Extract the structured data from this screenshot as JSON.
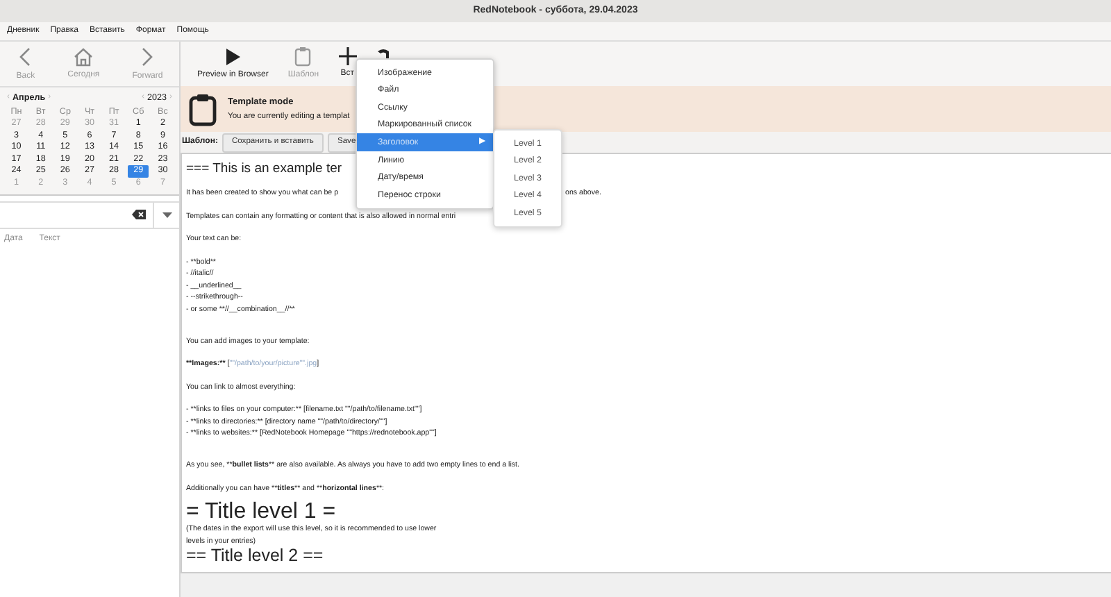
{
  "window": {
    "title": "RedNotebook - суббота, 29.04.2023"
  },
  "menubar": [
    "Дневник",
    "Правка",
    "Вставить",
    "Формат",
    "Помощь"
  ],
  "nav_buttons": [
    {
      "label": "Back",
      "kind": "back",
      "disabled": true
    },
    {
      "label": "Сегодня",
      "kind": "home",
      "disabled": true
    },
    {
      "label": "Forward",
      "kind": "forward",
      "disabled": true
    }
  ],
  "toolbar": [
    {
      "label": "Preview in Browser",
      "kind": "play",
      "disabled": false
    },
    {
      "label": "Шаблон",
      "kind": "template",
      "disabled": true
    },
    {
      "label": "Вст",
      "kind": "plus",
      "disabled": false
    },
    {
      "kind": "format",
      "disabled": false
    }
  ],
  "calendar": {
    "month": "Апрель",
    "year": "2023",
    "month_arrows": [
      "‹",
      "›"
    ],
    "year_arrows": [
      "‹",
      "›"
    ],
    "weekdays": [
      "Пн",
      "Вт",
      "Ср",
      "Чт",
      "Пт",
      "Сб",
      "Вс"
    ],
    "days": [
      {
        "day": "27",
        "other_month": true,
        "selected": false
      },
      {
        "day": "28",
        "other_month": true,
        "selected": false
      },
      {
        "day": "29",
        "other_month": true,
        "selected": false
      },
      {
        "day": "30",
        "other_month": true,
        "selected": false
      },
      {
        "day": "31",
        "other_month": true,
        "selected": false
      },
      {
        "day": "1",
        "other_month": false,
        "selected": false
      },
      {
        "day": "2",
        "other_month": false,
        "selected": false
      },
      {
        "day": "3",
        "other_month": false,
        "selected": false
      },
      {
        "day": "4",
        "other_month": false,
        "selected": false
      },
      {
        "day": "5",
        "other_month": false,
        "selected": false
      },
      {
        "day": "6",
        "other_month": false,
        "selected": false
      },
      {
        "day": "7",
        "other_month": false,
        "selected": false
      },
      {
        "day": "8",
        "other_month": false,
        "selected": false
      },
      {
        "day": "9",
        "other_month": false,
        "selected": false
      },
      {
        "day": "10",
        "other_month": false,
        "selected": false
      },
      {
        "day": "11",
        "other_month": false,
        "selected": false
      },
      {
        "day": "12",
        "other_month": false,
        "selected": false
      },
      {
        "day": "13",
        "other_month": false,
        "selected": false
      },
      {
        "day": "14",
        "other_month": false,
        "selected": false
      },
      {
        "day": "15",
        "other_month": false,
        "selected": false
      },
      {
        "day": "16",
        "other_month": false,
        "selected": false
      },
      {
        "day": "17",
        "other_month": false,
        "selected": false
      },
      {
        "day": "18",
        "other_month": false,
        "selected": false
      },
      {
        "day": "19",
        "other_month": false,
        "selected": false
      },
      {
        "day": "20",
        "other_month": false,
        "selected": false
      },
      {
        "day": "21",
        "other_month": false,
        "selected": false
      },
      {
        "day": "22",
        "other_month": false,
        "selected": false
      },
      {
        "day": "23",
        "other_month": false,
        "selected": false
      },
      {
        "day": "24",
        "other_month": false,
        "selected": false
      },
      {
        "day": "25",
        "other_month": false,
        "selected": false
      },
      {
        "day": "26",
        "other_month": false,
        "selected": false
      },
      {
        "day": "27",
        "other_month": false,
        "selected": false
      },
      {
        "day": "28",
        "other_month": false,
        "selected": false
      },
      {
        "day": "29",
        "other_month": false,
        "selected": true
      },
      {
        "day": "30",
        "other_month": false,
        "selected": false
      },
      {
        "day": "1",
        "other_month": true,
        "selected": false
      },
      {
        "day": "2",
        "other_month": true,
        "selected": false
      },
      {
        "day": "3",
        "other_month": true,
        "selected": false
      },
      {
        "day": "4",
        "other_month": true,
        "selected": false
      },
      {
        "day": "5",
        "other_month": true,
        "selected": false
      },
      {
        "day": "6",
        "other_month": true,
        "selected": false
      },
      {
        "day": "7",
        "other_month": true,
        "selected": false
      }
    ]
  },
  "entry_list": {
    "columns": [
      "Дата",
      "Текст"
    ]
  },
  "template_bar": {
    "title": "Template mode",
    "text": "You are currently editing a templat"
  },
  "template_actions": {
    "label": "Шаблон:",
    "buttons": [
      "Сохранить и вставить",
      "Save"
    ]
  },
  "editor": {
    "lines": [
      {
        "kind": "h3",
        "parts": [
          {
            "text": "=== This is an example ter"
          }
        ]
      },
      {
        "kind": "p",
        "parts": [
          {
            "text": "It has been created to show you what can be p"
          }
        ],
        "tail": "ons above."
      },
      {
        "kind": "p",
        "parts": [
          {
            "text": "Templates can contain any formatting or content that is also allowed in normal entri"
          }
        ]
      },
      {
        "kind": "p",
        "parts": [
          {
            "text": "Your text can be:"
          }
        ]
      },
      {
        "kind": "li",
        "parts": [
          {
            "text": "- **bold**"
          }
        ]
      },
      {
        "kind": "li",
        "parts": [
          {
            "text": "- //italic//"
          }
        ]
      },
      {
        "kind": "li",
        "parts": [
          {
            "text": "- __underlined__"
          }
        ]
      },
      {
        "kind": "li",
        "parts": [
          {
            "text": "- --strikethrough--"
          }
        ]
      },
      {
        "kind": "li",
        "parts": [
          {
            "text": "- or some **//__combination__//**"
          }
        ]
      },
      {
        "kind": "blank"
      },
      {
        "kind": "p",
        "parts": [
          {
            "text": "You can add images to your template:"
          }
        ]
      },
      {
        "kind": "p",
        "parts": [
          {
            "text": "**Images:**",
            "kind": "bold"
          },
          {
            "text": " ["
          },
          {
            "text": "\"\"/path/to/your/picture\"\".jpg",
            "kind": "link"
          },
          {
            "text": "]"
          }
        ]
      },
      {
        "kind": "p",
        "parts": [
          {
            "text": "You can link to almost everything:"
          }
        ]
      },
      {
        "kind": "li",
        "parts": [
          {
            "text": "- **links to files on your computer:** [filename.txt \"\"/path/to/filename.txt\"\"]"
          }
        ]
      },
      {
        "kind": "li",
        "parts": [
          {
            "text": "- **links to directories:** [directory name \"\"/path/to/directory/\"\"]"
          }
        ]
      },
      {
        "kind": "li",
        "parts": [
          {
            "text": "- **links to websites:** [RedNotebook Homepage \"\"https://rednotebook.app\"\"]"
          }
        ]
      },
      {
        "kind": "blank"
      },
      {
        "kind": "p",
        "parts": [
          {
            "text": "As you see, **"
          },
          {
            "text": "bullet lists",
            "kind": "bold"
          },
          {
            "text": "** are also available. As always you have to add two empty lines to end a list."
          }
        ]
      },
      {
        "kind": "p",
        "parts": [
          {
            "text": "Additionally you can have **"
          },
          {
            "text": "titles",
            "kind": "bold"
          },
          {
            "text": "** and **"
          },
          {
            "text": "horizontal lines",
            "kind": "bold"
          },
          {
            "text": "**:"
          }
        ]
      },
      {
        "kind": "h1",
        "parts": [
          {
            "text": "= Title level 1 ="
          }
        ]
      },
      {
        "kind": "li",
        "parts": [
          {
            "text": "(The dates in the export will use this level, so it is recommended to use lower"
          }
        ]
      },
      {
        "kind": "li",
        "parts": [
          {
            "text": "levels in your entries)"
          }
        ]
      },
      {
        "kind": "h2",
        "parts": [
          {
            "text": "== Title level 2 =="
          }
        ]
      }
    ]
  },
  "insert_menu": {
    "items": [
      {
        "label": "Изображение",
        "selected": false
      },
      {
        "label": "Файл",
        "selected": false
      },
      {
        "label": "Ссылку",
        "selected": false
      },
      {
        "label": "Маркированный список",
        "selected": false
      },
      {
        "label": "Заголовок",
        "selected": true,
        "arrow": "▶"
      },
      {
        "label": "Линию",
        "selected": false
      },
      {
        "label": "Дату/время",
        "selected": false
      },
      {
        "label": "Перенос строки",
        "selected": false
      }
    ],
    "submenu": [
      "Level 1",
      "Level 2",
      "Level 3",
      "Level 4",
      "Level 5"
    ]
  }
}
